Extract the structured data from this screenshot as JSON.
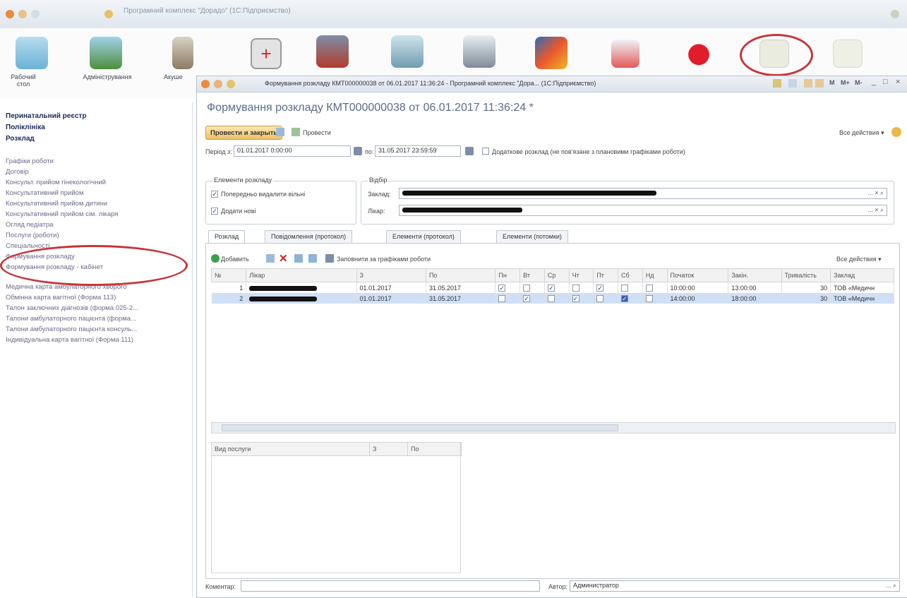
{
  "app_title": "Програмний комплекс \"Дорадо\" (1С:Підприємство)",
  "toolbar": {
    "items": [
      {
        "label": "Рабочий стол",
        "icon": "desk-icon"
      },
      {
        "label": "Адміністрування",
        "icon": "settings-gallery-icon"
      },
      {
        "label": "Акуше",
        "icon": "hourglass-icon"
      },
      {
        "label": "",
        "icon": "first-aid-icon"
      },
      {
        "label": "",
        "icon": "ambulance-icon"
      },
      {
        "label": "",
        "icon": "dental-chair-icon"
      },
      {
        "label": "",
        "icon": "cash-register-icon"
      },
      {
        "label": "",
        "icon": "cube-icon"
      },
      {
        "label": "",
        "icon": "medical-kit-icon"
      },
      {
        "label": "",
        "icon": "heart-icon"
      },
      {
        "label": "",
        "icon": "schedule-icon"
      },
      {
        "label": "",
        "icon": "schedule-icon-2"
      }
    ]
  },
  "left_nav": {
    "bold_items": [
      "Перинатальний реєстр",
      "Поліклініка",
      "Розклад"
    ],
    "group1": [
      "Графіки роботи",
      "Договір",
      "Консульт. прийом гінекологічний",
      "Консультативний прийом",
      "Консультативний прийом дитини",
      "Консультативний прийом сім. лікаря",
      "Огляд педіатра",
      "Послуги (роботи)",
      "Спеціальності",
      "Формування розкладу",
      "Формування розкладу - кабінет"
    ],
    "group2": [
      "Медична карта амбулаторного хворого",
      "Обмінна карта вагітної (Форма 113)",
      "Талон заключних діагнозів (форма 025-2...",
      "Талони амбулаторного пацієнта (форма...",
      "Талони амбулаторного пацієнта консуль...",
      "Індивідуальна карта вагітної (Форма 111)"
    ]
  },
  "inner_window": {
    "title": "Формування розкладу КМТ000000038 от 06.01.2017 11:36:24 - Програмний комплекс \"Дора... (1С:Підприємство)",
    "title_buttons": [
      "M",
      "M+",
      "M-"
    ]
  },
  "document": {
    "heading": "Формування розкладу КМТ000000038 от 06.01.2017 11:36:24 *",
    "post_close_button": "Провести и закрыть",
    "post_button": "Провести",
    "all_actions": "Все действия ▾",
    "period_label": "Період з:",
    "period_from": "01.01.2017 0:00:00",
    "period_to_label": "по:",
    "period_to": "31.05.2017 23:59:59",
    "additional_schedule_label": "Додаткове розклад (не пов'язане з плановими графіками роботи)",
    "elements_group": "Елементи розкладу",
    "delete_free_label": "Попередньо видалити вільні",
    "add_new_label": "Додати нові",
    "filter_group": "Відбір",
    "facility_label": "Заклад:",
    "doctor_label": "Лікар:",
    "comment_label": "Коментар:",
    "author_label": "Автор:",
    "author_value": "Администратор"
  },
  "tabs": [
    "Розклад",
    "Повідомлення (протокол)",
    "Елементи (протокол)",
    "Елементи (потомки)"
  ],
  "grid_toolbar": {
    "add_label": "Добавить",
    "fill_label": "Заповнити за графіками роботи",
    "all_actions": "Все действия ▾"
  },
  "schedule_table": {
    "headers": [
      "№",
      "Лікар",
      "З",
      "По",
      "Пн",
      "Вт",
      "Ср",
      "Чт",
      "Пт",
      "Сб",
      "Нд",
      "Початок",
      "Закін.",
      "Тривалість",
      "Заклад"
    ],
    "rows": [
      {
        "n": "1",
        "from": "01.01.2017",
        "to": "31.05.2017",
        "days": [
          true,
          false,
          true,
          false,
          true,
          false,
          false
        ],
        "start": "10:00:00",
        "end": "13:00:00",
        "duration": "30",
        "facility": "ТОВ «Медичн"
      },
      {
        "n": "2",
        "from": "01.01.2017",
        "to": "31.05.2017",
        "days": [
          false,
          true,
          false,
          true,
          false,
          true,
          false
        ],
        "start": "14:00:00",
        "end": "18:00:00",
        "duration": "30",
        "facility": "ТОВ «Медичн"
      }
    ]
  },
  "services_table": {
    "headers": [
      "Вид послуги",
      "З",
      "По"
    ]
  },
  "colors": {
    "annotation": "#c7353a",
    "heading": "#5a6c8a",
    "selection": "#cfdff5"
  }
}
